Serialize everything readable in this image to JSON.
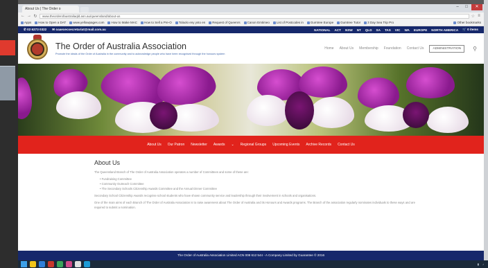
{
  "browser": {
    "tab_title": "About Us | The Order o",
    "url": "www.theorderofaustraliaqld.asn.au/queensland/about-us",
    "bookmarks": [
      "Apps",
      "How to Open a DAT",
      "www.yellowpages.com",
      "How to Make MAC",
      "How to Sell a Pre-O",
      "Tolaolo eny ysto en",
      "Request of Queenrs",
      "Canon Emtimeo",
      "List of Postcodes in",
      "Gumtree Europe",
      "Gumtree Tutor",
      "3 Day Sea Trip Pro"
    ],
    "other_bookmarks": "Other bookmarks"
  },
  "topbar": {
    "phone": "02 6273 0322",
    "email": "oaaexecsecretariat@mail.com.au",
    "regions": [
      "NATIONAL",
      "ACT",
      "NSW",
      "NT",
      "QLD",
      "SA",
      "TAS",
      "VIC",
      "WA",
      "EUROPE",
      "NORTH AMERICA"
    ],
    "cart": "0 items"
  },
  "header": {
    "title": "The Order of Australia Association",
    "subtitle": "Promote the ideals of the Order of Australia in the community and to acknowledge people who have been recognised through the honours system",
    "nav": [
      "Home",
      "About Us",
      "Membership",
      "Foundation",
      "Contact Us"
    ],
    "admin_label": "ADMINISTRATION"
  },
  "rednav": [
    "About Us",
    "Our Patron",
    "Newsletter",
    "Awards",
    "Regional Groups",
    "Upcoming Events",
    "Archive Records",
    "Contact Us"
  ],
  "content": {
    "heading": "About Us",
    "intro": "The Queensland Branch of The Order of Australia Association operates a number of Committees and some of these are:",
    "list": [
      "Fundraising Committee",
      "Community Outreach Committee",
      "The Secondary Schools Citizenship Awards Committee and the Annual Dinner Committee"
    ],
    "para1": "Secondary School Citizenship Awards recognise school students who have shown community service and leadership through their involvement in schools and organisations.",
    "para2": "One of the main aims of each Branch of The Order of Australia Association is to raise awareness about The Order of Australia and its Honours and Awards programs. The Branch of the association regularly nominates individuals to these ways and are required to submit a nomination."
  },
  "footer": "The Order of Australia Association Limited ACN 008 612 544 - A Company Limited by Guarantee © 2016",
  "colors": {
    "navy": "#16286b",
    "red": "#e1231c"
  }
}
